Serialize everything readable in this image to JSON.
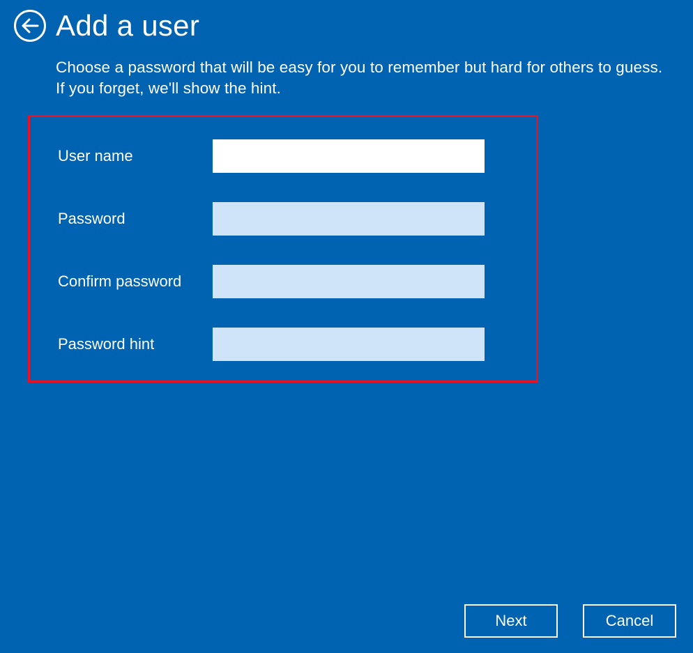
{
  "header": {
    "title": "Add a user"
  },
  "instructions": "Choose a password that will be easy for you to remember but hard for others to guess. If you forget, we'll show the hint.",
  "form": {
    "username": {
      "label": "User name",
      "value": ""
    },
    "password": {
      "label": "Password",
      "value": ""
    },
    "confirm": {
      "label": "Confirm password",
      "value": ""
    },
    "hint": {
      "label": "Password hint",
      "value": ""
    }
  },
  "buttons": {
    "next": "Next",
    "cancel": "Cancel"
  }
}
